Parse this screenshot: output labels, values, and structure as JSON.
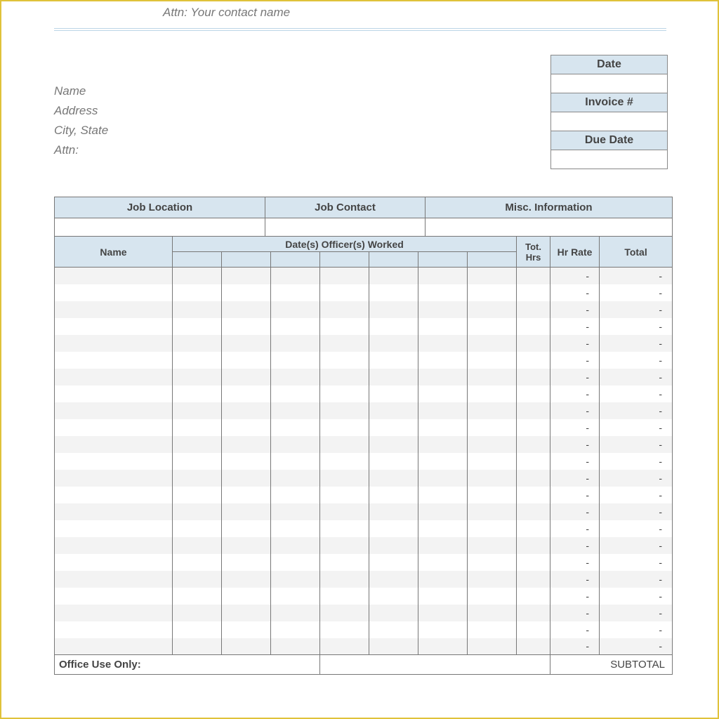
{
  "top_attn": "Attn: Your contact name",
  "address_block": {
    "name": "Name",
    "address": "Address",
    "city_state": "City, State",
    "attn": "Attn:"
  },
  "meta": {
    "date_label": "Date",
    "date_value": "",
    "invoice_label": "Invoice #",
    "invoice_value": "",
    "due_label": "Due Date",
    "due_value": ""
  },
  "info_headers": {
    "job_location": "Job Location",
    "job_contact": "Job Contact",
    "misc_info": "Misc. Information"
  },
  "work_headers": {
    "name": "Name",
    "dates_worked": "Date(s) Officer(s) Worked",
    "tot_hrs": "Tot. Hrs",
    "hr_rate": "Hr Rate",
    "total": "Total"
  },
  "dash": "-",
  "row_count": 23,
  "footer": {
    "office_use": "Office Use Only:",
    "subtotal": "SUBTOTAL"
  }
}
